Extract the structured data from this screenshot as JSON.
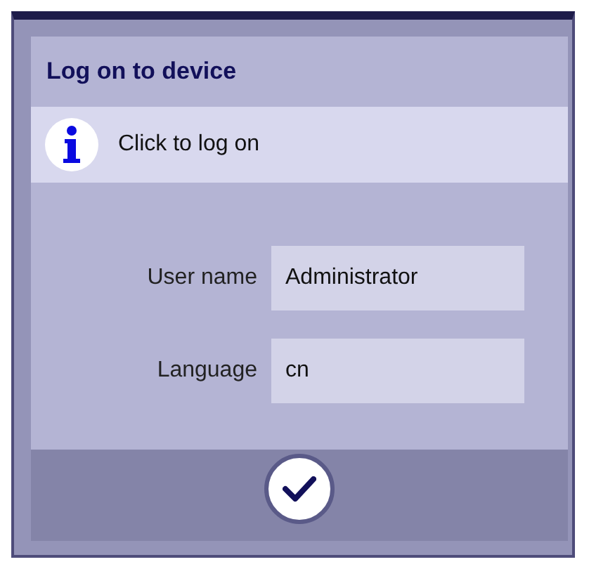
{
  "dialog": {
    "title": "Log on to device",
    "info": "Click to log on",
    "fields": [
      {
        "label": "User name",
        "value": "Administrator"
      },
      {
        "label": "Language",
        "value": "cn"
      }
    ]
  }
}
